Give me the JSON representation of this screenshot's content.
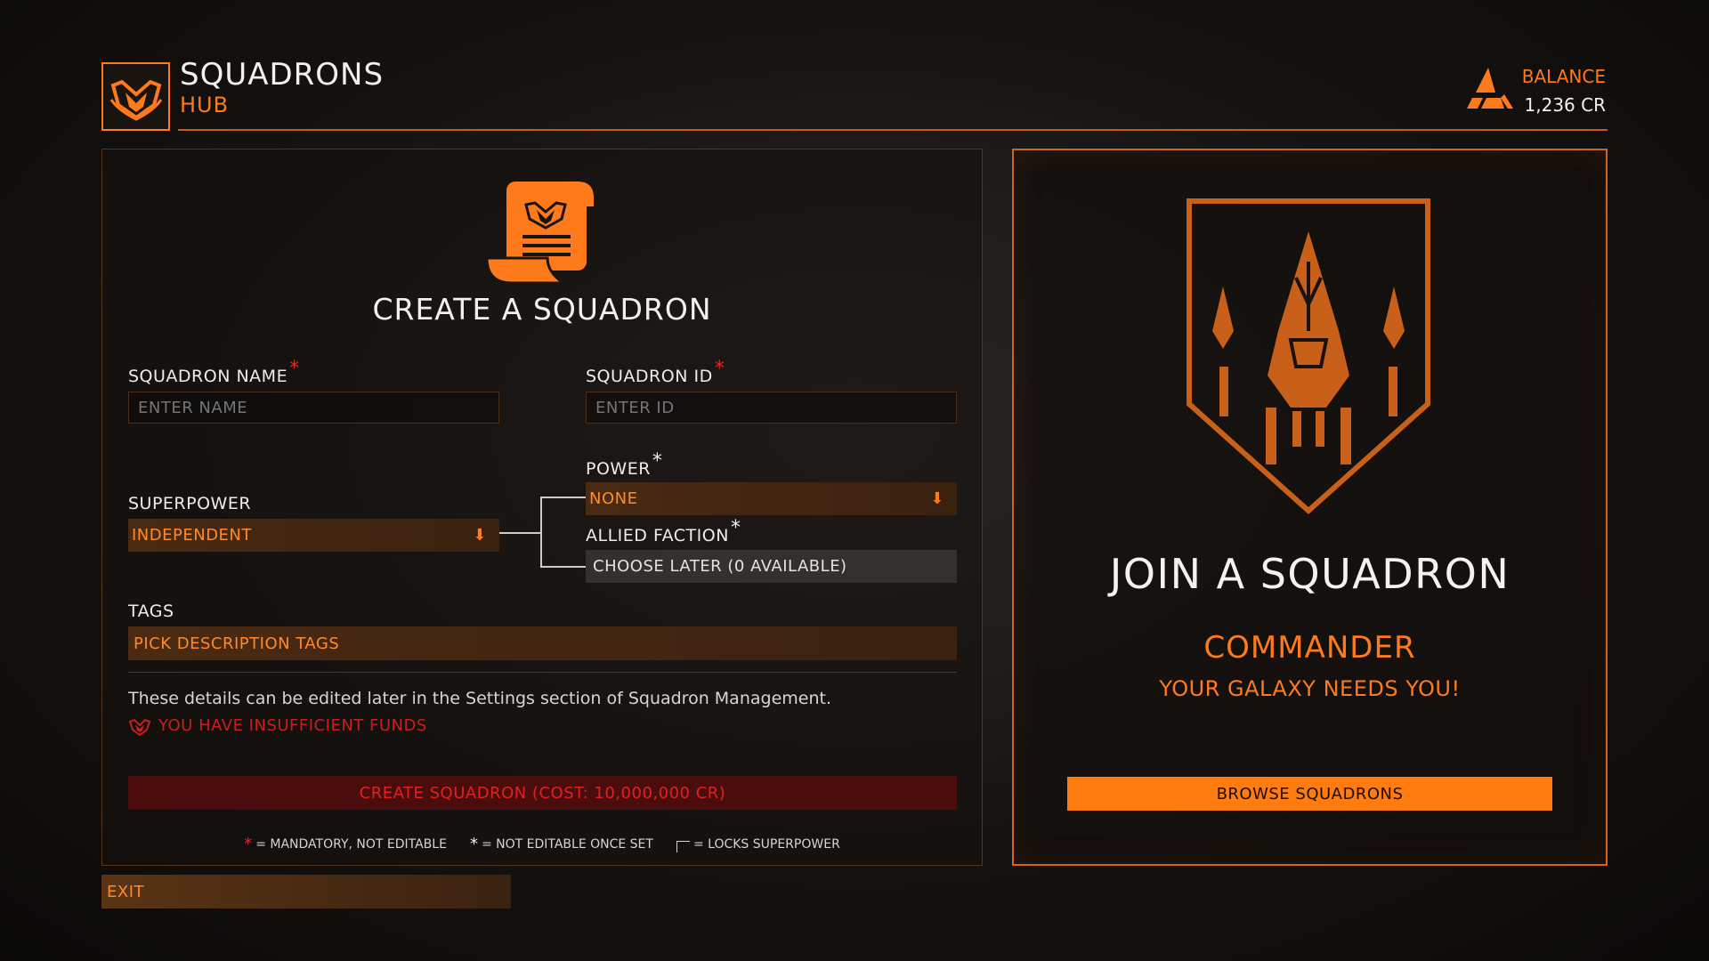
{
  "header": {
    "title": "SQUADRONS",
    "subtitle": "HUB",
    "balance_label": "BALANCE",
    "balance_value": "1,236 CR",
    "emblem_icon": "squadron-emblem-icon",
    "balance_icon": "faction-triangle-icon"
  },
  "create": {
    "title": "CREATE A SQUADRON",
    "icon": "scroll-charter-icon",
    "name_label": "SQUADRON NAME",
    "name_placeholder": "ENTER NAME",
    "id_label": "SQUADRON ID",
    "id_placeholder": "ENTER ID",
    "power_label": "POWER",
    "power_value": "NONE",
    "superpower_label": "SUPERPOWER",
    "superpower_value": "INDEPENDENT",
    "allied_label": "ALLIED FACTION",
    "allied_value": "CHOOSE LATER (0 AVAILABLE)",
    "tags_label": "TAGS",
    "tags_value": "PICK DESCRIPTION TAGS",
    "info_text": "These details can be edited later in the Settings section of Squadron Management.",
    "funds_warning": "YOU HAVE INSUFFICIENT FUNDS",
    "create_button": "CREATE SQUADRON (COST: 10,000,000 CR)",
    "required_mark": "*",
    "legend": {
      "mandatory": "= MANDATORY, NOT EDITABLE",
      "once_set": "= NOT EDITABLE ONCE SET",
      "locks": "= LOCKS SUPERPOWER"
    }
  },
  "join": {
    "title": "JOIN A SQUADRON",
    "subtitle": "COMMANDER",
    "tagline": "YOUR GALAXY NEEDS YOU!",
    "browse_button": "BROWSE SQUADRONS",
    "emblem_icon": "squadron-shield-ship-icon"
  },
  "footer": {
    "exit_button": "EXIT"
  },
  "colors": {
    "accent": "#ff7a1a",
    "warning": "#c81e1e",
    "text": "#f2efec"
  }
}
